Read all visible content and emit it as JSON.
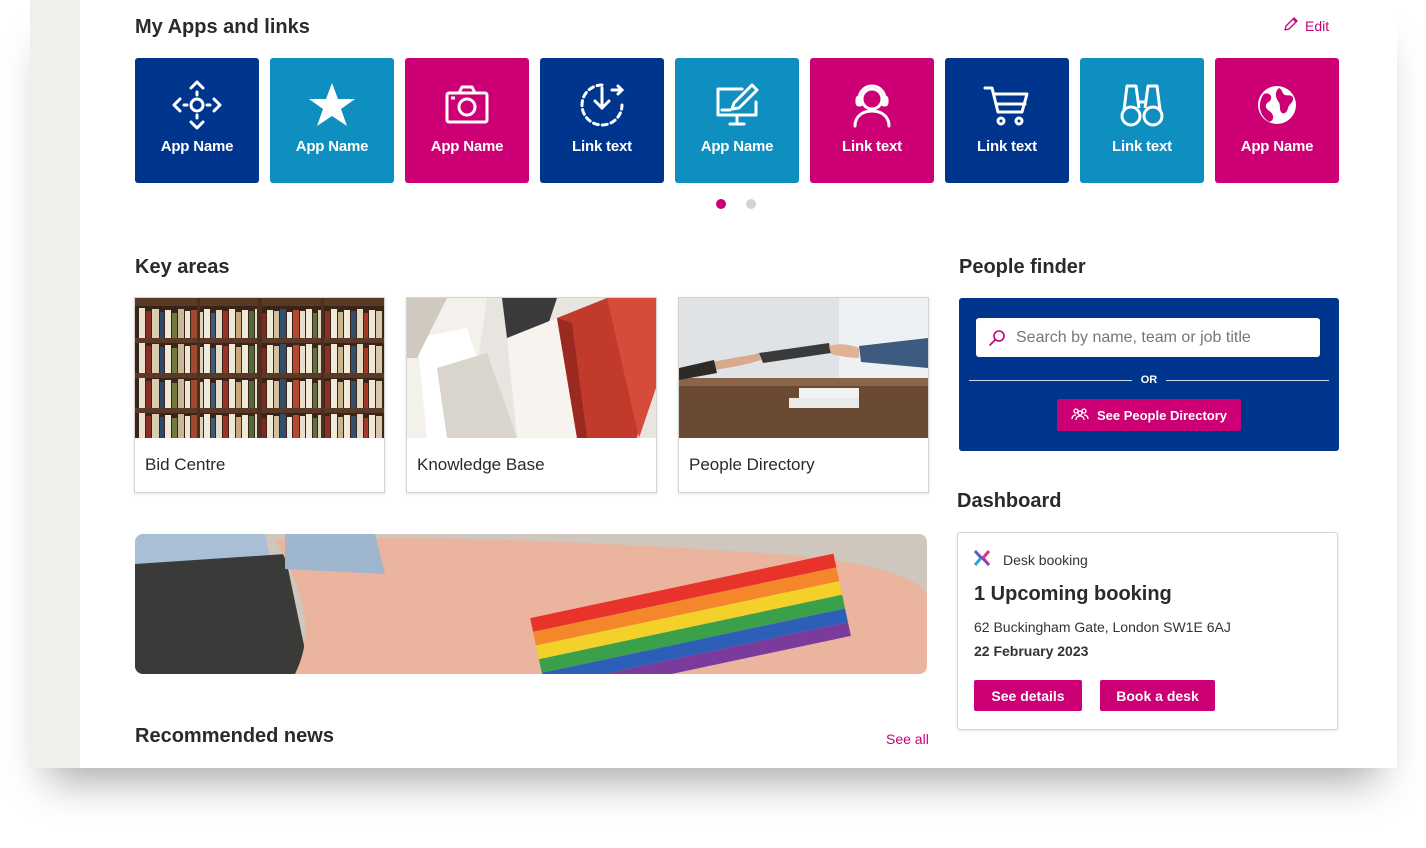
{
  "apps": {
    "heading": "My Apps and links",
    "edit_label": "Edit",
    "tiles": [
      {
        "label": "App Name",
        "icon": "settings-move-icon",
        "color": "navy"
      },
      {
        "label": "App Name",
        "icon": "star-icon",
        "color": "teal"
      },
      {
        "label": "App Name",
        "icon": "camera-icon",
        "color": "pink"
      },
      {
        "label": "Link text",
        "icon": "download-progress-icon",
        "color": "navy"
      },
      {
        "label": "App Name",
        "icon": "monitor-edit-icon",
        "color": "teal"
      },
      {
        "label": "Link text",
        "icon": "headset-user-icon",
        "color": "pink"
      },
      {
        "label": "Link text",
        "icon": "shopping-cart-icon",
        "color": "navy"
      },
      {
        "label": "Link text",
        "icon": "binoculars-icon",
        "color": "teal"
      },
      {
        "label": "App Name",
        "icon": "globe-icon",
        "color": "pink"
      }
    ],
    "pagination": {
      "pages": 2,
      "current": 1
    }
  },
  "key_areas": {
    "heading": "Key areas",
    "cards": [
      {
        "label": "Bid Centre"
      },
      {
        "label": "Knowledge Base"
      },
      {
        "label": "People Directory"
      }
    ]
  },
  "people_finder": {
    "heading": "People finder",
    "search_placeholder": "Search by name, team or job title",
    "or_label": "OR",
    "directory_button": "See People Directory"
  },
  "dashboard": {
    "heading": "Dashboard",
    "widget_title": "Desk booking",
    "summary": "1 Upcoming booking",
    "address": "62 Buckingham Gate, London SW1E 6AJ",
    "date": "22 February 2023",
    "details_button": "See details",
    "book_button": "Book a desk"
  },
  "news": {
    "heading": "Recommended news",
    "see_all": "See all"
  },
  "colors": {
    "navy": "#00358e",
    "teal": "#0f8ec0",
    "pink": "#cc0074"
  }
}
